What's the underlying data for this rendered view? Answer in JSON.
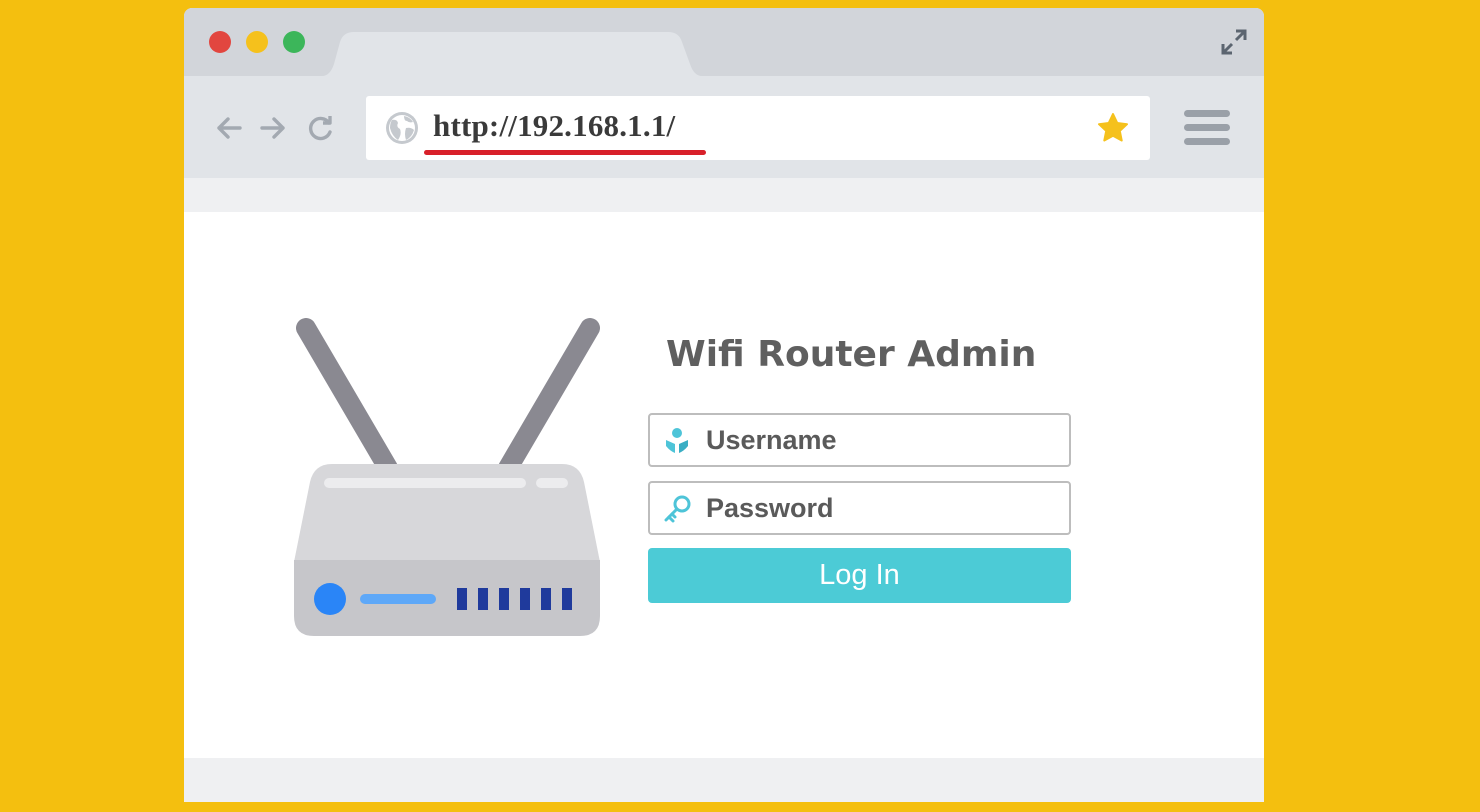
{
  "window": {
    "controls": [
      "close-icon",
      "minimize-icon",
      "maximize-icon"
    ],
    "expand_icon": "expand-arrows-icon"
  },
  "toolbar": {
    "nav_icons": [
      "arrow-left-icon",
      "arrow-right-icon",
      "reload-icon"
    ],
    "address": {
      "site_icon": "globe-icon",
      "url": "http://192.168.1.1/",
      "bookmark_icon": "star-icon"
    },
    "menu_icon": "hamburger-menu-icon"
  },
  "login": {
    "title": "Wifi Router Admin",
    "username_placeholder": "Username",
    "password_placeholder": "Password",
    "button_label": "Log In"
  },
  "colors": {
    "page_background": "#f4bf0f",
    "url_underline": "#d8202a",
    "bookmark_star": "#f5c11c",
    "button": "#4ccbd6",
    "field_icon": "#4ec4d8"
  }
}
